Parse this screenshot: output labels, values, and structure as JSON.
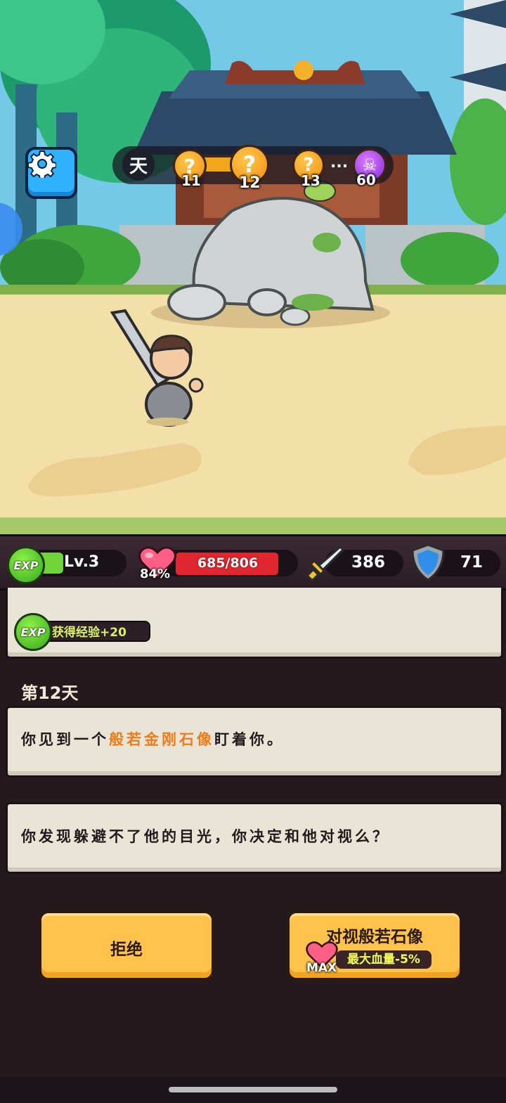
{
  "game": {
    "day_progress": {
      "day_char": "天",
      "nodes": [
        {
          "type": "mystery",
          "glyph": "?",
          "day": "11"
        },
        {
          "type": "mystery",
          "glyph": "?",
          "day": "12"
        },
        {
          "type": "mystery",
          "glyph": "?",
          "day": "13"
        },
        {
          "type": "boss",
          "glyph": "☠",
          "day": "60"
        }
      ],
      "ellipsis": "..."
    }
  },
  "stats": {
    "exp_badge": "EXP",
    "level": "Lv.3",
    "hp": "685/806",
    "hp_percent": "84%",
    "attack": "386",
    "defense": "71"
  },
  "log": {
    "exp_gain_badge": "EXP",
    "exp_gain": "获得经验+20",
    "day_title": "第12天",
    "event_line_prefix": "你见到一个",
    "event_line_highlight": "般若金刚石像",
    "event_line_suffix": "盯着你。",
    "question": "你发现躲避不了他的目光，你决定和他对视么？"
  },
  "choices": {
    "refuse_label": "拒绝",
    "accept_label": "对视般若石像",
    "accept_cost": "最大血量-5%",
    "accept_cost_tag": "MAX"
  },
  "colors": {
    "highlight": "#f07b1a",
    "button": "#ffc24a",
    "hp": "#e0262e",
    "exp": "#6fd43a"
  }
}
